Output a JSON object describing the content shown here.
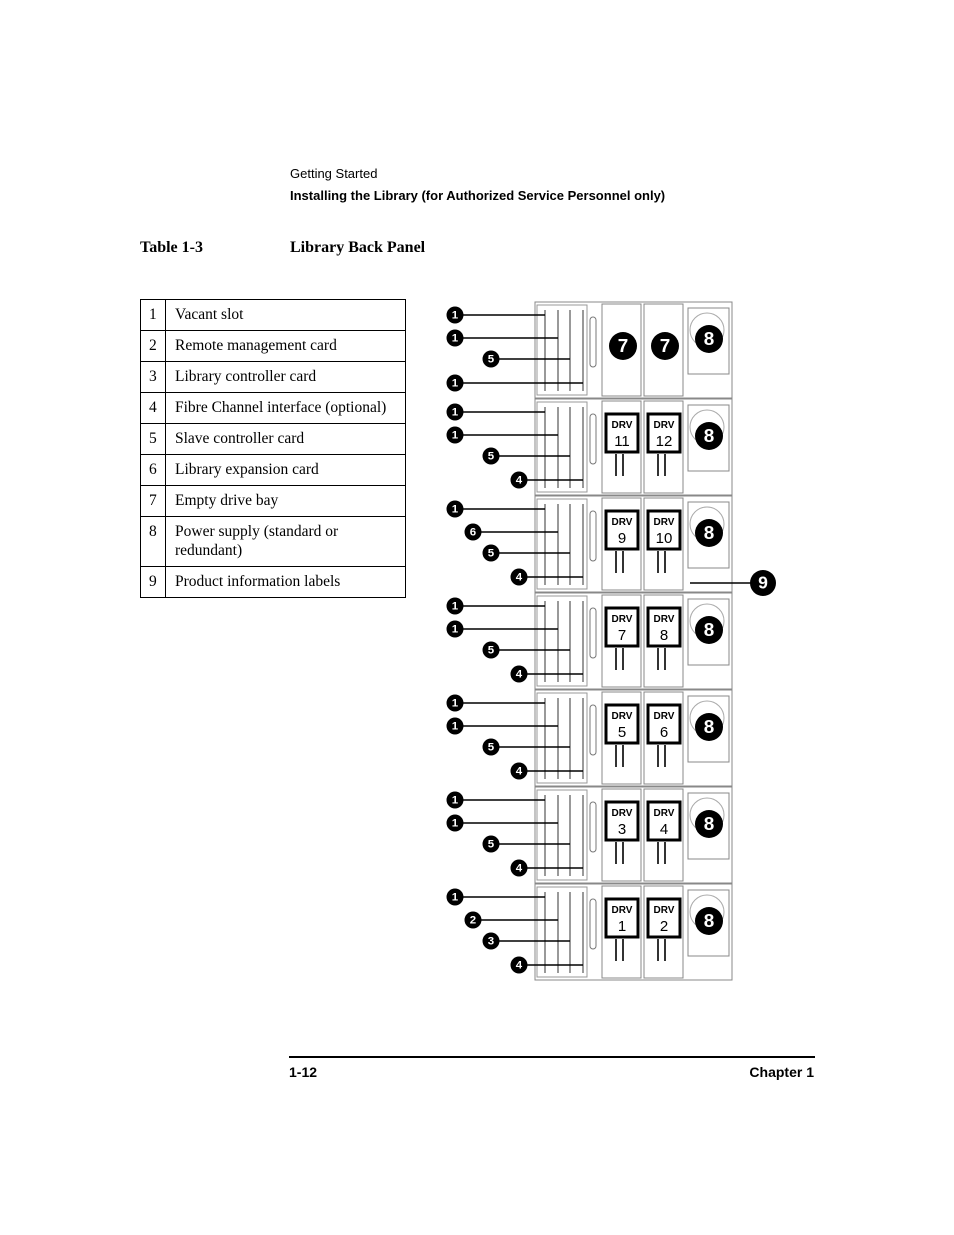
{
  "header": {
    "section": "Getting Started",
    "subsection": "Installing the Library (for Authorized Service Personnel only)"
  },
  "table": {
    "caption": "Table 1-3",
    "title": "Library Back Panel",
    "rows": [
      {
        "num": "1",
        "desc": "Vacant slot"
      },
      {
        "num": "2",
        "desc": "Remote management card"
      },
      {
        "num": "3",
        "desc": "Library controller card"
      },
      {
        "num": "4",
        "desc": "Fibre Channel interface (optional)"
      },
      {
        "num": "5",
        "desc": "Slave controller card"
      },
      {
        "num": "6",
        "desc": "Library expansion card"
      },
      {
        "num": "7",
        "desc": "Empty drive bay"
      },
      {
        "num": "8",
        "desc": "Power supply (standard or redundant)"
      },
      {
        "num": "9",
        "desc": "Product information labels"
      }
    ]
  },
  "diagram": {
    "drive_prefix": "DRV",
    "modules": [
      {
        "callouts": [
          "1",
          "1",
          "5",
          "1"
        ],
        "drives": [
          null,
          null
        ],
        "psu": "8"
      },
      {
        "callouts": [
          "1",
          "1",
          "5",
          "4"
        ],
        "drives": [
          "11",
          "12"
        ],
        "psu": "8"
      },
      {
        "callouts": [
          "1",
          "6",
          "5",
          "4"
        ],
        "drives": [
          "9",
          "10"
        ],
        "psu": "8"
      },
      {
        "callouts": [
          "1",
          "1",
          "5",
          "4"
        ],
        "drives": [
          "7",
          "8"
        ],
        "psu": "8"
      },
      {
        "callouts": [
          "1",
          "1",
          "5",
          "4"
        ],
        "drives": [
          "5",
          "6"
        ],
        "psu": "8"
      },
      {
        "callouts": [
          "1",
          "1",
          "5",
          "4"
        ],
        "drives": [
          "3",
          "4"
        ],
        "psu": "8"
      },
      {
        "callouts": [
          "1",
          "2",
          "3",
          "4"
        ],
        "drives": [
          "1",
          "2"
        ],
        "psu": "8"
      }
    ],
    "empty_bay_label": "7",
    "label_callout": "9"
  },
  "footer": {
    "page": "1-12",
    "chapter": "Chapter 1"
  }
}
